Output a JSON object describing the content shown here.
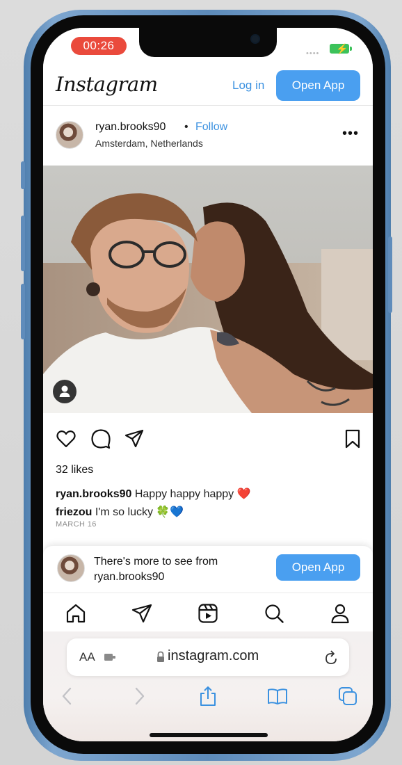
{
  "status_bar": {
    "recording_time": "00:26",
    "signal": "••••"
  },
  "header": {
    "logo": "Instagram",
    "login_label": "Log in",
    "open_app_label": "Open App"
  },
  "post": {
    "username": "ryan.brooks90",
    "separator": "•",
    "follow_label": "Follow",
    "location": "Amsterdam, Netherlands",
    "more_label": "•••",
    "likes": "32 likes",
    "captions": [
      {
        "user": "ryan.brooks90",
        "text": "Happy happy happy ❤️"
      },
      {
        "user": "friezou",
        "text": "I'm so lucky 🍀💙"
      }
    ],
    "date": "MARCH 16"
  },
  "banner": {
    "line1": "There's more to see from",
    "line2": "ryan.brooks90",
    "button_label": "Open App"
  },
  "safari": {
    "aa_label": "AA",
    "url": "instagram.com"
  },
  "colors": {
    "accent": "#4a9ff0",
    "link": "#3b91e0",
    "recording": "#ea4a3c",
    "battery": "#3cc25a",
    "frame": "#6a96c3"
  }
}
